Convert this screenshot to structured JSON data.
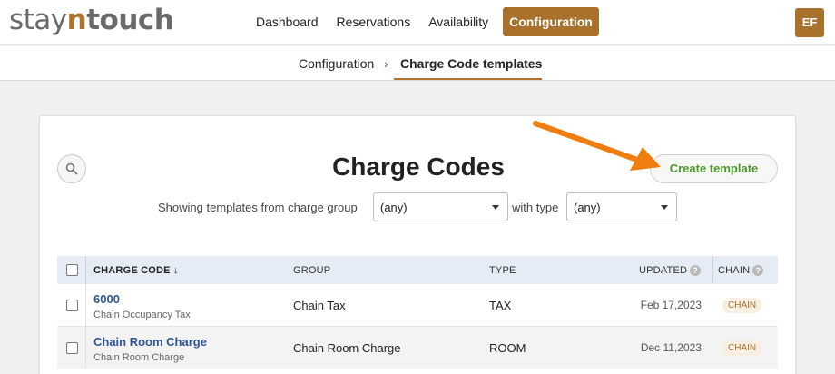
{
  "brand": {
    "logo_part1": "stay",
    "logo_part2": "n",
    "logo_part3": "touch"
  },
  "nav": {
    "items": [
      {
        "label": "Dashboard"
      },
      {
        "label": "Reservations"
      },
      {
        "label": "Availability"
      },
      {
        "label": "Configuration",
        "active": true
      }
    ]
  },
  "user": {
    "initials": "EF"
  },
  "breadcrumb": {
    "parent": "Configuration",
    "separator": "›",
    "current": "Charge Code templates"
  },
  "page": {
    "title": "Charge Codes",
    "create_button": "Create template",
    "filter": {
      "prefix": "Showing templates from charge group",
      "group_value": "(any)",
      "middle": "with type",
      "type_value": "(any)"
    }
  },
  "table": {
    "headers": {
      "charge_code": "CHARGE CODE ↓",
      "group": "GROUP",
      "type": "TYPE",
      "updated": "UPDATED",
      "chain": "CHAIN"
    },
    "help_mark": "?",
    "rows": [
      {
        "code": "6000",
        "description": "Chain Occupancy Tax",
        "group": "Chain Tax",
        "type": "TAX",
        "updated": "Feb 17,2023",
        "chain": "CHAIN"
      },
      {
        "code": "Chain Room Charge",
        "description": "Chain Room Charge",
        "group": "Chain Room Charge",
        "type": "ROOM",
        "updated": "Dec 11,2023",
        "chain": "CHAIN"
      }
    ]
  },
  "colors": {
    "brand_brown": "#a8712c",
    "create_green": "#4d9a2c",
    "link_blue": "#2f5597",
    "annotation_arrow": "#f07d10"
  },
  "icons": {
    "search": "search-icon",
    "caret": "chevron-down-icon",
    "arrow": "arrow-annotation-icon"
  }
}
